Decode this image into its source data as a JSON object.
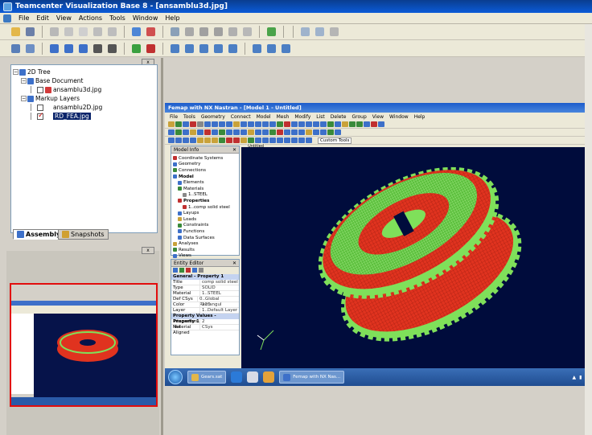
{
  "window": {
    "title": "Teamcenter Visualization Base 8 - [ansamblu3d.jpg]"
  },
  "menu": [
    "File",
    "Edit",
    "View",
    "Actions",
    "Tools",
    "Window",
    "Help"
  ],
  "tree": {
    "close_label": "x",
    "root": "2D Tree",
    "base_document": "Base Document",
    "base_file": "ansamblu3d.jpg",
    "markup_layers": "Markup Layers",
    "layer_1": "ansamblu2D.jpg",
    "layer_2": "RD_FEA.jpg"
  },
  "tabs": {
    "assembly": "Assembly",
    "snapshots": "Snapshots"
  },
  "thumb_panel": {
    "close_label": "x"
  },
  "femap": {
    "title": "Femap with NX Nastran - [Model 1 - Untitled]",
    "menu": [
      "File",
      "Tools",
      "Geometry",
      "Connect",
      "Model",
      "Mesh",
      "Modify",
      "List",
      "Delete",
      "Group",
      "View",
      "Window",
      "Help"
    ],
    "custom_tools": "Custom Tools",
    "graphics_tab": "Untitled"
  },
  "model_info": {
    "title": "Model Info",
    "items": [
      "Coordinate Systems",
      "Geometry",
      "Connections",
      "Model",
      "Elements",
      "Materials",
      "1..STEEL",
      "Properties",
      "1..comp solid steel",
      "Layups",
      "Loads",
      "Constraints",
      "Functions",
      "Data Surfaces",
      "Analyses",
      "Results",
      "Views"
    ]
  },
  "entity_editor": {
    "title": "Entity Editor",
    "section_1": "General - Property 1",
    "rows": [
      {
        "k": "Title",
        "v": "comp solid steel"
      },
      {
        "k": "Type",
        "v": "SOLID"
      },
      {
        "k": "Material",
        "v": "1..STEEL"
      },
      {
        "k": "Def CSys",
        "v": "0..Global Rectangul"
      },
      {
        "k": "Color",
        "v": "110"
      },
      {
        "k": "Layer",
        "v": "1..Default Layer"
      }
    ],
    "section_2": "Property Values - Property 1",
    "rows2": [
      {
        "k": "Integration Net",
        "v": "2"
      },
      {
        "k": "Material Aligned",
        "v": "CSys"
      }
    ]
  },
  "taskbar": {
    "task_1": "Gears.sat",
    "task_2": "Femap with NX Nas..."
  },
  "colors": {
    "mesh_red": "#e0331f",
    "mesh_green": "#7fe05a",
    "viewport_bg": "#000c3c",
    "thumb_border": "#e20d0d"
  }
}
